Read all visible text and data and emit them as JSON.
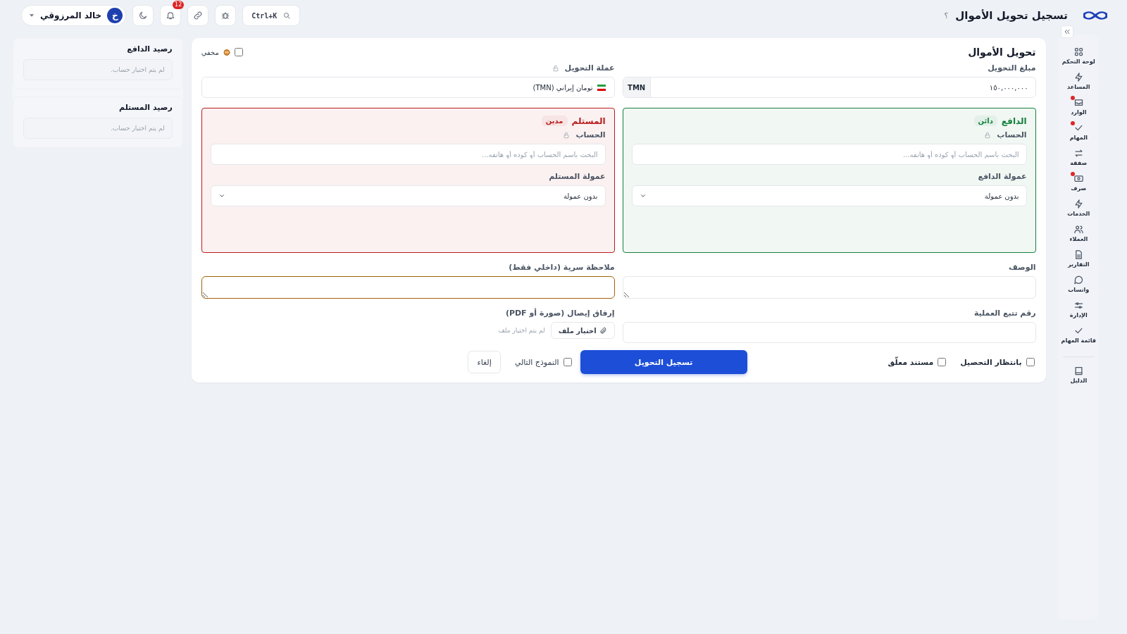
{
  "header": {
    "title": "تسجيل تحويل الأموال",
    "help": "؟",
    "search": {
      "shortcut": "Ctrl+K"
    },
    "notifications": {
      "count": "12"
    },
    "user": {
      "initial": "خ",
      "name": "خالد المرزوقي"
    }
  },
  "sidebar": {
    "items": [
      {
        "label": "لوحة التحكم",
        "dot": false
      },
      {
        "label": "المساعد",
        "dot": false
      },
      {
        "label": "الوارد",
        "dot": true
      },
      {
        "label": "المهام",
        "dot": true
      },
      {
        "label": "صفقة",
        "dot": false
      },
      {
        "label": "صرف",
        "dot": true
      },
      {
        "label": "الخدمات",
        "dot": false
      },
      {
        "label": "العملاء",
        "dot": false
      },
      {
        "label": "التقارير",
        "dot": false
      },
      {
        "label": "واتساب",
        "dot": false
      },
      {
        "label": "الإدارة",
        "dot": false
      },
      {
        "label": "قائمة المهام",
        "dot": false
      }
    ],
    "footer_items": [
      {
        "label": "الدليل",
        "dot": false
      }
    ]
  },
  "form": {
    "title": "تحويل الأموال",
    "hidden": {
      "label": "مخفي",
      "checked": false
    },
    "amount": {
      "label": "مبلغ التحويل",
      "value": "١٥٠,٠٠٠,٠٠٠",
      "currency": "TMN"
    },
    "currency": {
      "label": "عملة التحويل",
      "value": "تومان إيراني (TMN)"
    },
    "parties": [
      {
        "title": "الدافع",
        "badge": "دائن",
        "color": "#15803d",
        "account_label": "الحساب",
        "placeholder": "البحث باسم الحساب أو كوده أو هاتفه...",
        "commission_label": "عمولة الدافع",
        "commission_value": "بدون عمولة"
      },
      {
        "title": "المستلم",
        "badge": "مدين",
        "color": "#b91c1c",
        "account_label": "الحساب",
        "placeholder": "البحث باسم الحساب أو كوده أو هاتفه...",
        "commission_label": "عمولة المستلم",
        "commission_value": "بدون عمولة"
      }
    ],
    "description": {
      "label": "الوصف",
      "focused": false
    },
    "note": {
      "label": "ملاحظة سرية (داخلي فقط)",
      "focused": true
    },
    "tracking": {
      "label": "رقم تتبع العملية"
    },
    "attachment": {
      "label": "إرفاق إيصال (صورة أو PDF)",
      "button": "اختيار ملف",
      "status": "لم يتم اختيار ملف"
    },
    "options": [
      {
        "label": "بانتظار التحصيل",
        "checked": false
      },
      {
        "label": "مستند معلّق",
        "checked": false
      }
    ],
    "submit": "تسجيل التحويل",
    "next_form": {
      "label": "النموذج التالي",
      "checked": false
    },
    "cancel": "إلغاء"
  },
  "balances": [
    {
      "title": "رصيد الدافع",
      "text": "لم يتم اختيار حساب."
    },
    {
      "title": "رصيد المستلم",
      "text": "لم يتم اختيار حساب."
    }
  ]
}
